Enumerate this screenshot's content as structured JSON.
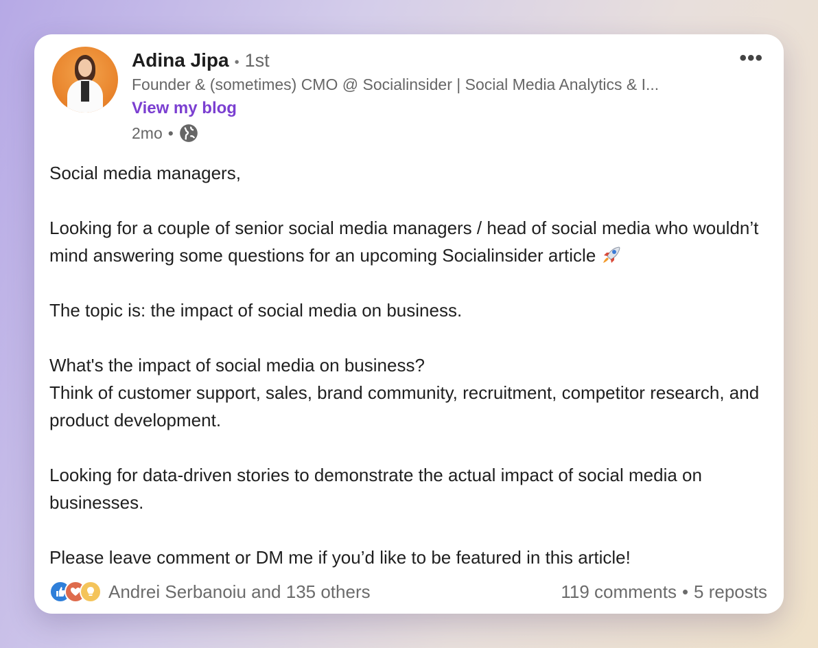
{
  "author": {
    "name": "Adina Jipa",
    "connection_degree": "1st",
    "headline": "Founder & (sometimes) CMO @ Socialinsider | Social Media Analytics & I...",
    "link_label": "View my blog",
    "time_ago": "2mo",
    "visibility_icon": "globe-icon"
  },
  "menu_icon": "more-options-icon",
  "post": {
    "paragraphs": [
      "Social media managers,",
      "Looking for a couple of senior social media managers / head of social media who wouldn’t mind answering some questions for an upcoming Socialinsider article",
      "The topic is: the impact of social media on business.",
      "What's the impact of social media on business?",
      "Think of customer support, sales, brand community, recruitment, competitor research, and product development.",
      "Looking for data-driven stories to demonstrate the actual impact of social media on businesses.",
      "Please leave comment or DM me if you’d like to be featured in this article!"
    ],
    "emoji": "rocket-emoji"
  },
  "footer": {
    "reaction_icons": [
      "like-icon",
      "love-icon",
      "insightful-icon"
    ],
    "reactions_text": "Andrei Serbanoiu and 135 others",
    "comments": "119 comments",
    "separator": "•",
    "reposts": "5 reposts"
  },
  "colors": {
    "link": "#7b3fd1",
    "like": "#2f7fd9",
    "love": "#de6b4c",
    "insight": "#f4c45b"
  }
}
